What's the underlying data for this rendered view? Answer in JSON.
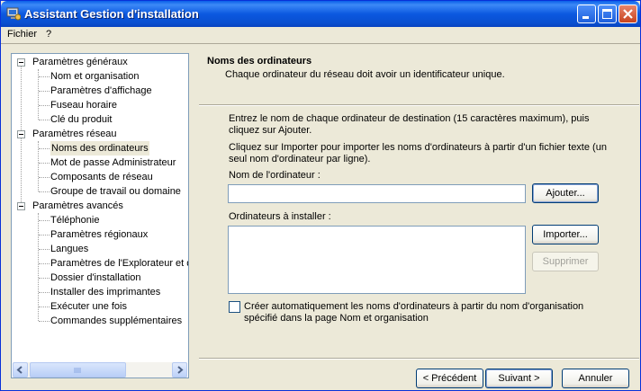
{
  "window": {
    "title": "Assistant Gestion d'installation"
  },
  "menu": {
    "file": "Fichier",
    "help": "?"
  },
  "tree": {
    "general": {
      "label": "Paramètres généraux",
      "items": [
        "Nom et organisation",
        "Paramètres d'affichage",
        "Fuseau horaire",
        "Clé du produit"
      ]
    },
    "network": {
      "label": "Paramètres réseau",
      "items": [
        "Noms des ordinateurs",
        "Mot de passe Administrateur",
        "Composants de réseau",
        "Groupe de travail ou domaine"
      ]
    },
    "advanced": {
      "label": "Paramètres avancés",
      "items": [
        "Téléphonie",
        "Paramètres régionaux",
        "Langues",
        "Paramètres de l'Explorateur et de",
        "Dossier d'installation",
        "Installer des imprimantes",
        "Exécuter une fois",
        "Commandes supplémentaires"
      ]
    },
    "selected": "Noms des ordinateurs"
  },
  "header": {
    "title": "Noms des ordinateurs",
    "subtitle": "Chaque ordinateur du réseau doit avoir un identificateur unique."
  },
  "content": {
    "instruction1_line1": "Entrez le nom de chaque ordinateur de destination (15 caractères maximum), puis",
    "instruction1_line2": "cliquez sur Ajouter.",
    "instruction2_line1": "Cliquez sur Importer pour importer les noms d'ordinateurs à partir d'un fichier texte (un",
    "instruction2_line2": "seul nom d'ordinateur par ligne).",
    "name_label": "Nom de l'ordinateur :",
    "name_value": "",
    "add_button": "Ajouter...",
    "list_label": "Ordinateurs à installer :",
    "import_button": "Importer...",
    "delete_button": "Supprimer",
    "auto_checkbox_checked": false,
    "auto_line1": "Créer automatiquement les noms d'ordinateurs à partir du nom d'organisation",
    "auto_line2": "spécifié dans la page Nom et organisation"
  },
  "footer": {
    "back": "< Précédent",
    "next": "Suivant >",
    "cancel": "Annuler"
  },
  "icons": {
    "app": "setup-manager-icon",
    "minimize": "minimize-icon",
    "maximize": "maximize-icon",
    "close": "close-icon",
    "scroll_left": "arrow-left-icon",
    "scroll_right": "arrow-right-icon"
  }
}
